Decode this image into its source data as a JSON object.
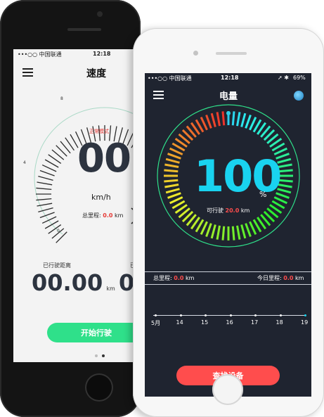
{
  "speed_screen": {
    "status": {
      "carrier": "•••○○ 中国联通",
      "time": "12:18"
    },
    "title": "速度",
    "mode": "正常模式",
    "speed": "00",
    "unit": "km/h",
    "ticks": [
      "8",
      "4",
      "0"
    ],
    "total_mileage_label": "总里程:",
    "total_mileage_value": "0.0",
    "total_mileage_unit": "km",
    "distance_label": "已行驶距离",
    "distance_value": "00.00",
    "distance_unit": "km",
    "cut_label": "已",
    "cut_value": "0",
    "start_button": "开始行驶"
  },
  "battery_screen": {
    "status": {
      "carrier": "•••○○ 中国联通",
      "time": "12:18",
      "battery": "69%"
    },
    "title": "电量",
    "percent": "100",
    "percent_sign": "%",
    "range_label": "可行驶",
    "range_value": "20.0",
    "range_unit": "km",
    "total_mileage_label": "总里程:",
    "total_mileage_value": "0.0",
    "total_mileage_unit": "km",
    "today_mileage_label": "今日里程:",
    "today_mileage_value": "0.0",
    "today_mileage_unit": "km",
    "timeline": [
      "5月",
      "14",
      "15",
      "16",
      "17",
      "18",
      "19"
    ],
    "find_button": "查找设备"
  },
  "colors": {
    "green": "#2fe08a",
    "red": "#ff4d4d",
    "cyan": "#19d3f0",
    "dark_bg": "#1f2430"
  }
}
